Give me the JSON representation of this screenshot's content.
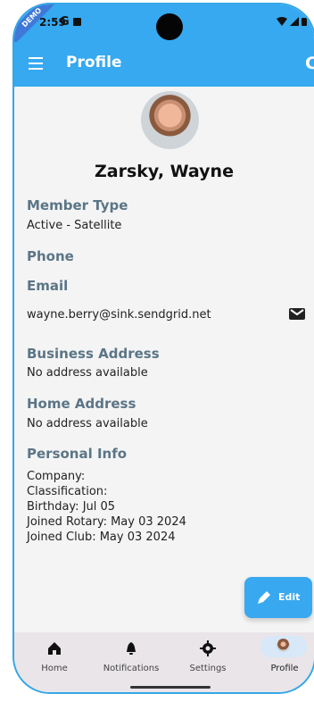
{
  "status": {
    "time": "2:59",
    "google": "G"
  },
  "demo": "DEMO",
  "app_bar": {
    "title": "Profile",
    "icon_menu": "menu-icon",
    "icon_refresh": "refresh-icon"
  },
  "profile": {
    "name": "Zarsky, Wayne",
    "member_type_title": "Member Type",
    "member_type_value": "Active - Satellite",
    "phone_title": "Phone",
    "email_title": "Email",
    "email_value": "wayne.berry@sink.sendgrid.net",
    "business_address_title": "Business Address",
    "business_address_value": "No address available",
    "home_address_title": "Home Address",
    "home_address_value": "No address available",
    "personal_info_title": "Personal Info",
    "personal_info_lines": [
      "Company:",
      "Classification:",
      "Birthday: Jul 05",
      "Joined Rotary: May 03 2024",
      "Joined Club: May 03 2024"
    ]
  },
  "actions": {
    "edit": "Edit"
  },
  "bottom_nav": [
    {
      "label": "Home",
      "icon": "home-icon"
    },
    {
      "label": "Notifications",
      "icon": "notifications-icon"
    },
    {
      "label": "Settings",
      "icon": "settings-icon"
    },
    {
      "label": "Profile",
      "icon": "profile-avatar-icon",
      "active": true
    }
  ],
  "colors": {
    "primary": "#36a9f0",
    "section_title": "#5b7586",
    "nav_background": "#e9e5e9"
  }
}
